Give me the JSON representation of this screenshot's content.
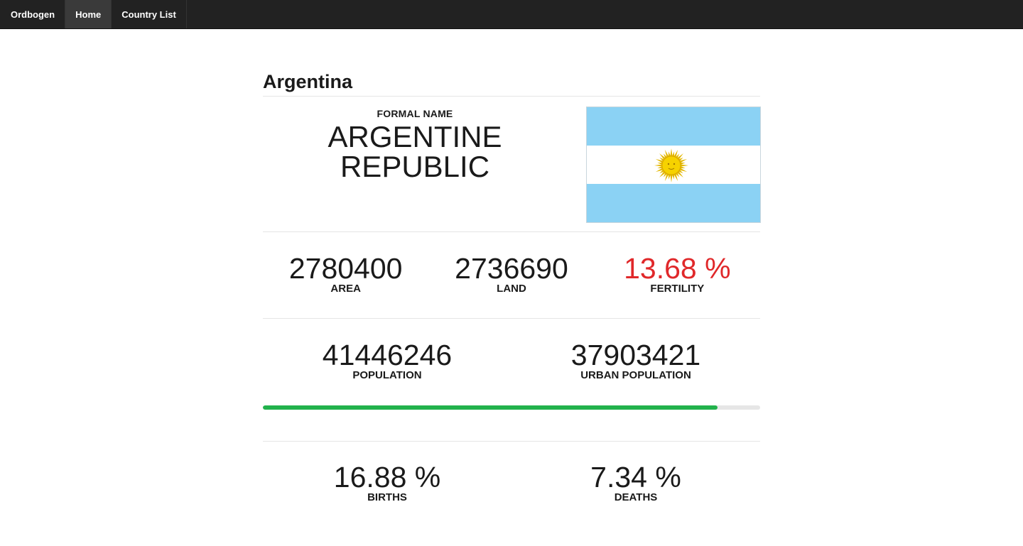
{
  "nav": {
    "brand": "Ordbogen",
    "items": [
      {
        "label": "Home",
        "active": true
      },
      {
        "label": "Country List",
        "active": false
      }
    ]
  },
  "country": {
    "name": "Argentina",
    "formal_label": "FORMAL NAME",
    "formal_name": "ARGENTINE REPUBLIC",
    "flag_icon": "argentina-flag-icon"
  },
  "stats": {
    "area": {
      "value": "2780400",
      "label": "AREA"
    },
    "land": {
      "value": "2736690",
      "label": "LAND"
    },
    "fertility": {
      "value": "13.68 %",
      "label": "FERTILITY",
      "color": "#e0282a"
    },
    "population": {
      "value": "41446246",
      "label": "POPULATION"
    },
    "urban_population": {
      "value": "37903421",
      "label": "URBAN POPULATION"
    },
    "urban_share": {
      "fraction": 0.9145,
      "color": "#22b24c",
      "track_color": "#e6e6e6"
    },
    "births": {
      "value": "16.88 %",
      "label": "BIRTHS"
    },
    "deaths": {
      "value": "7.34 %",
      "label": "DEATHS"
    }
  },
  "colors": {
    "navbar": "#222222",
    "flag_blue": "#8bd2f4",
    "sun": "#f6d200"
  }
}
